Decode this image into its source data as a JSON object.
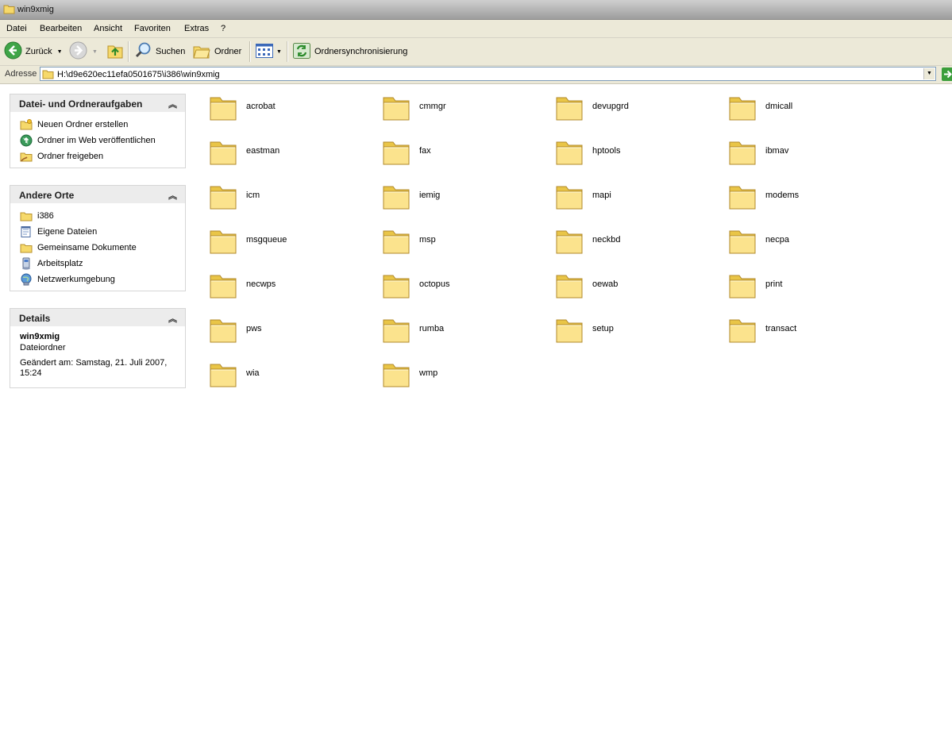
{
  "window": {
    "title": "win9xmig"
  },
  "menu": [
    "Datei",
    "Bearbeiten",
    "Ansicht",
    "Favoriten",
    "Extras",
    "?"
  ],
  "toolbar": {
    "back": "Zurück",
    "search": "Suchen",
    "folders": "Ordner",
    "sync": "Ordnersynchronisierung"
  },
  "address": {
    "label": "Adresse",
    "value": "H:\\d9e620ec11efa0501675\\i386\\win9xmig"
  },
  "tasks": {
    "title": "Datei- und Ordneraufgaben",
    "items": [
      "Neuen Ordner erstellen",
      "Ordner im Web veröffentlichen",
      "Ordner freigeben"
    ]
  },
  "places": {
    "title": "Andere Orte",
    "items": [
      "i386",
      "Eigene Dateien",
      "Gemeinsame Dokumente",
      "Arbeitsplatz",
      "Netzwerkumgebung"
    ]
  },
  "details": {
    "title": "Details",
    "name": "win9xmig",
    "type": "Dateiordner",
    "modified": "Geändert am: Samstag, 21. Juli 2007, 15:24"
  },
  "folders": [
    "acrobat",
    "cmmgr",
    "devupgrd",
    "dmicall",
    "eastman",
    "fax",
    "hptools",
    "ibmav",
    "icm",
    "iemig",
    "mapi",
    "modems",
    "msgqueue",
    "msp",
    "neckbd",
    "necpa",
    "necwps",
    "octopus",
    "oewab",
    "print",
    "pws",
    "rumba",
    "setup",
    "transact",
    "wia",
    "wmp"
  ]
}
